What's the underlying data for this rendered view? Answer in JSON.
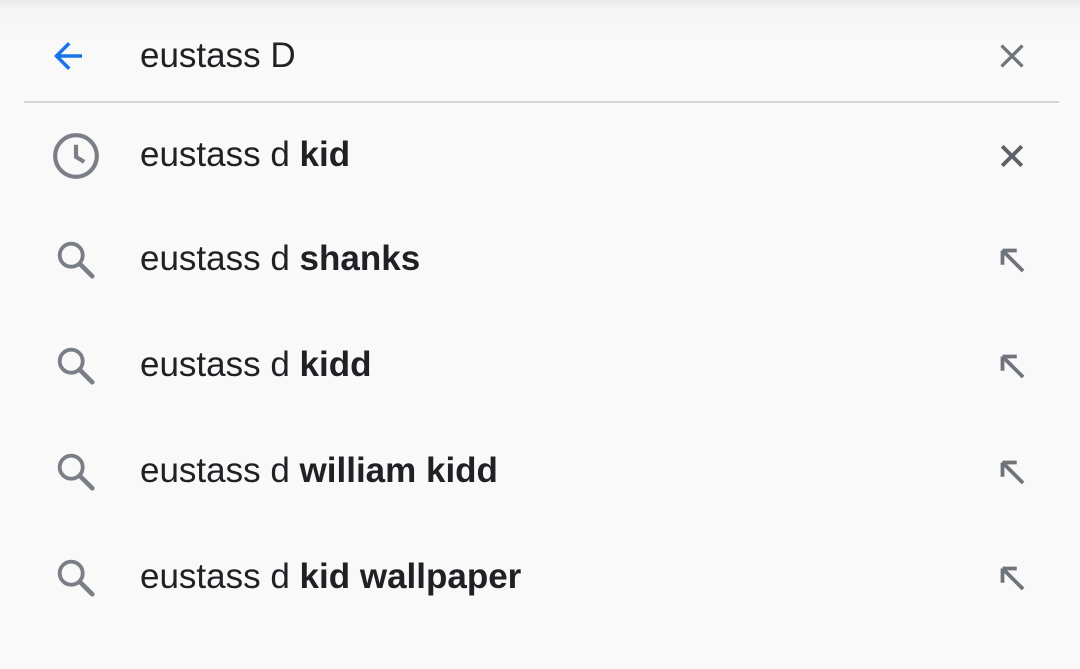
{
  "search": {
    "query": "eustass D",
    "back_icon": "arrow-left-icon",
    "clear_icon": "close-icon"
  },
  "colors": {
    "accent": "#1a73e8",
    "icon_gray": "#7a7f86",
    "text": "#202124",
    "divider": "#d5d5d7"
  },
  "suggestions": [
    {
      "prefix": "eustass d ",
      "completion": "kid",
      "type": "history",
      "lead_icon": "history-clock-icon",
      "action_icon": "remove-icon"
    },
    {
      "prefix": "eustass d ",
      "completion": "shanks",
      "type": "search",
      "lead_icon": "search-icon",
      "action_icon": "fill-query-arrow-icon"
    },
    {
      "prefix": "eustass d ",
      "completion": "kidd",
      "type": "search",
      "lead_icon": "search-icon",
      "action_icon": "fill-query-arrow-icon"
    },
    {
      "prefix": "eustass d ",
      "completion": "william kidd",
      "type": "search",
      "lead_icon": "search-icon",
      "action_icon": "fill-query-arrow-icon"
    },
    {
      "prefix": "eustass d ",
      "completion": "kid wallpaper",
      "type": "search",
      "lead_icon": "search-icon",
      "action_icon": "fill-query-arrow-icon"
    }
  ]
}
